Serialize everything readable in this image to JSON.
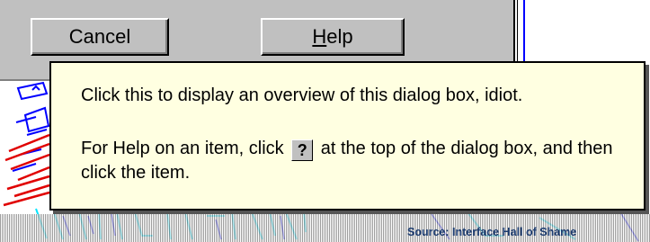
{
  "dialog": {
    "cancel_label": "Cancel",
    "help_label_accel": "H",
    "help_label_rest": "elp"
  },
  "tooltip": {
    "line1": "Click this to display an overview of this dialog box, idiot.",
    "line2_before": "For Help on an item, click",
    "help_glyph": "?",
    "line2_after": "at the top of the dialog box, and then click the item."
  },
  "source": "Source: Interface Hall of Shame",
  "colors": {
    "dialog_face": "#c0c0c0",
    "tooltip_bg": "#ffffe1",
    "drawing_blue": "#0000ff",
    "drawing_cyan": "#00e5ff",
    "drawing_red": "#e00000",
    "source_text": "#1a3a6e"
  }
}
